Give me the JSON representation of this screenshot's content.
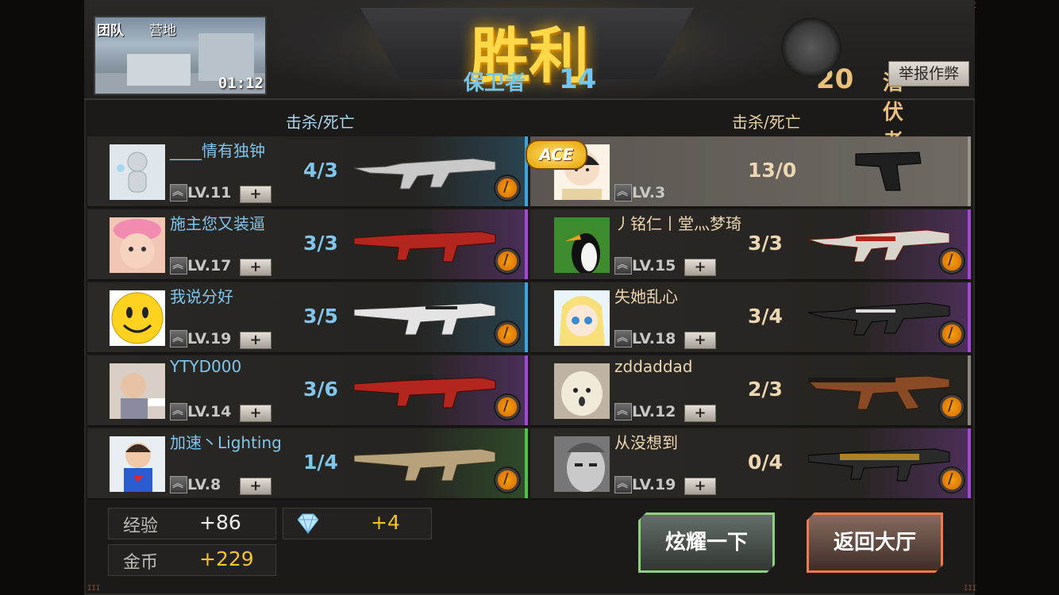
{
  "header": {
    "mode": "团队",
    "map": "营地",
    "time": "01:12",
    "result": "胜利",
    "report_button": "举报作弊"
  },
  "teams": {
    "left": {
      "name": "保卫者",
      "score": "14",
      "color": "#73c6ef"
    },
    "right": {
      "name": "潜伏者",
      "score": "20",
      "color": "#e9c07c"
    }
  },
  "columns": {
    "left_kd_header": "击杀/死亡",
    "right_kd_header": "击杀/死亡"
  },
  "left_players": [
    {
      "name": "____情有独钟",
      "level": "LV.11",
      "kd": "4/3",
      "weapon_icon": "assault-rifle-silver",
      "row_accent": "#3aa6e0"
    },
    {
      "name": "施主您又装逼",
      "level": "LV.17",
      "kd": "3/3",
      "weapon_icon": "rifle-red-camo",
      "row_accent": "#a24ad8"
    },
    {
      "name": "我说分好",
      "level": "LV.19",
      "kd": "3/5",
      "weapon_icon": "scar-rifle-white",
      "row_accent": "#3aa6e0"
    },
    {
      "name": "YTYD000",
      "level": "LV.14",
      "kd": "3/6",
      "weapon_icon": "rifle-red-camo",
      "row_accent": "#a24ad8"
    },
    {
      "name": "加速丶Lighting",
      "level": "LV.8",
      "kd": "1/4",
      "weapon_icon": "scar-rifle-tan",
      "row_accent": "#4fbf4a"
    }
  ],
  "right_players": [
    {
      "name": "",
      "level": "LV.3",
      "kd": "13/0",
      "weapon_icon": "pistol-black",
      "ace": "ACE",
      "row_accent": "#9a948d"
    },
    {
      "name": "丿铭仁丨堂灬梦琦",
      "level": "LV.15",
      "kd": "3/3",
      "weapon_icon": "assault-rifle-dragon",
      "row_accent": "#a24ad8"
    },
    {
      "name": "失她乱心",
      "level": "LV.18",
      "kd": "3/4",
      "weapon_icon": "assault-rifle-black",
      "row_accent": "#a24ad8"
    },
    {
      "name": "zddaddad",
      "level": "LV.12",
      "kd": "2/3",
      "weapon_icon": "ak47-wood",
      "row_accent": "#8c8680"
    },
    {
      "name": "从没想到",
      "level": "LV.19",
      "kd": "0/4",
      "weapon_icon": "rifle-gold-pattern",
      "row_accent": "#a24ad8"
    }
  ],
  "rewards": {
    "exp_label": "经验",
    "exp_value": "+86",
    "gem_value": "+4",
    "gold_label": "金币",
    "gold_value": "+229"
  },
  "buttons": {
    "show_off": "炫耀一下",
    "back_lobby": "返回大厅"
  },
  "add_friend_symbol": "+"
}
